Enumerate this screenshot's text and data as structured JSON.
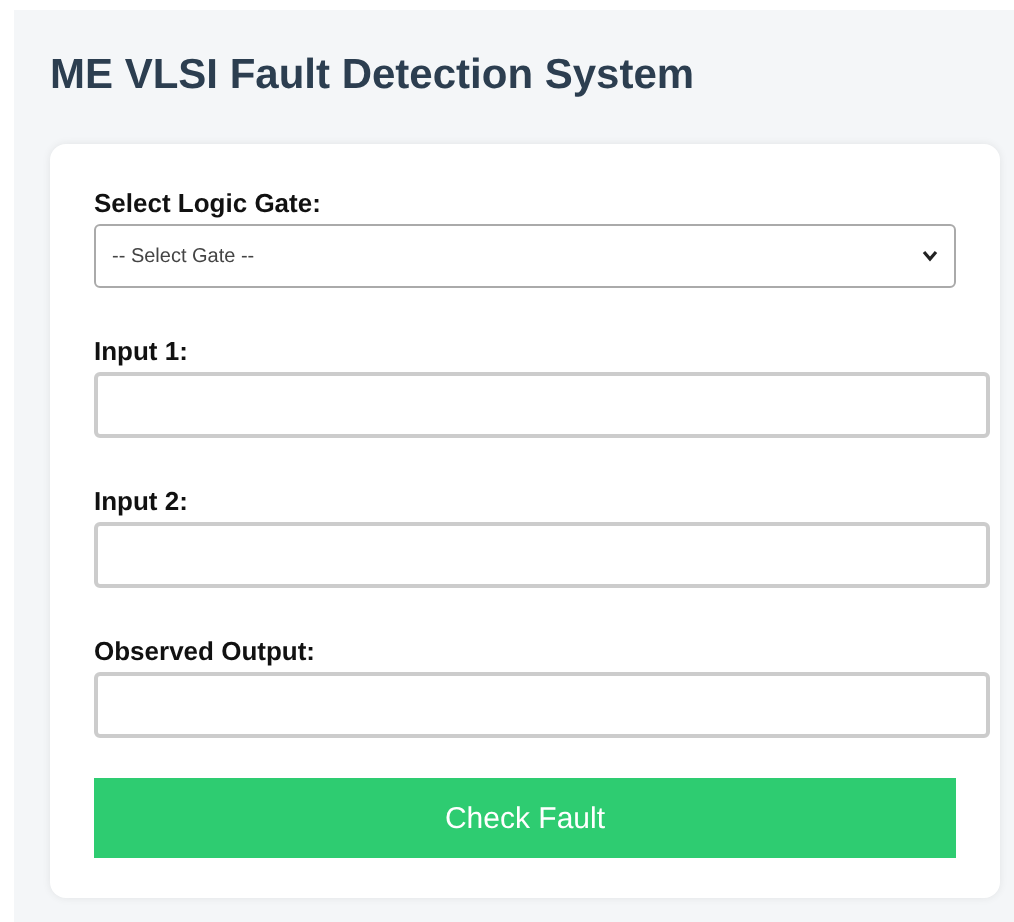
{
  "title": "ME VLSI Fault Detection System",
  "form": {
    "fields": [
      {
        "kind": "select",
        "label": "Select Logic Gate:",
        "value": "-- Select Gate --"
      },
      {
        "kind": "input",
        "label": "Input 1:"
      },
      {
        "kind": "input",
        "label": "Input 2:"
      },
      {
        "kind": "input",
        "label": "Observed Output:"
      }
    ],
    "button": "Check Fault"
  }
}
